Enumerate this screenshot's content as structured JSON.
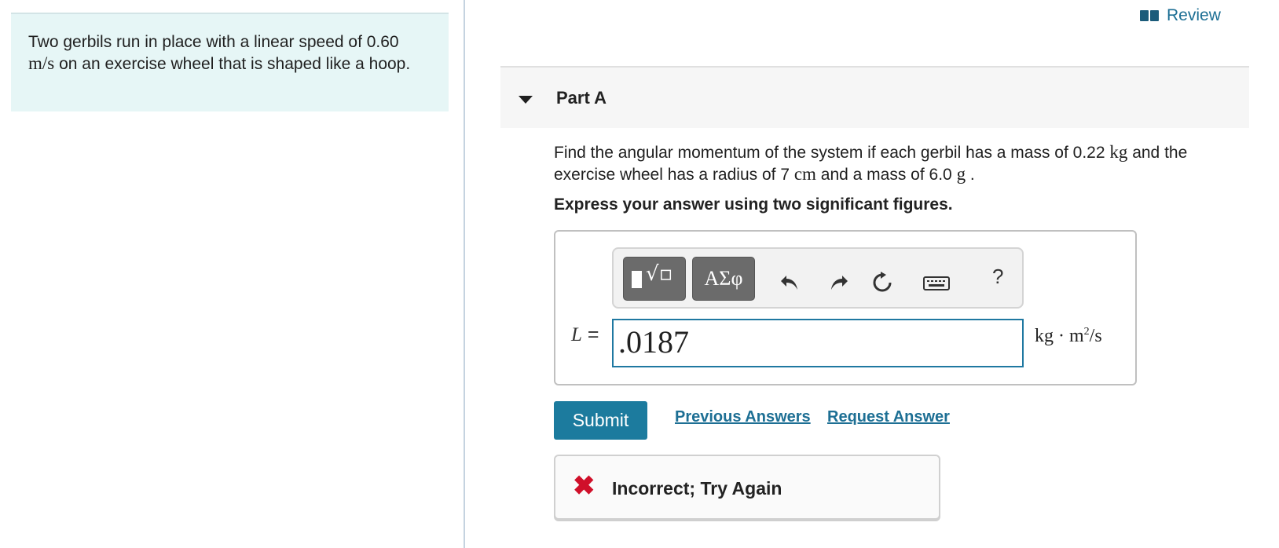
{
  "intro": {
    "text_before": "Two gerbils run in place with a linear speed of 0.60",
    "unit": "m/s",
    "text_after": " on an exercise wheel that is shaped like a hoop."
  },
  "review": {
    "label": "Review",
    "icon": "book-icon"
  },
  "part": {
    "title": "Part A",
    "caret": "caret-down-icon"
  },
  "question": {
    "t1": "Find the angular momentum of the system if each gerbil has a mass of 0.22 ",
    "u1": "kg",
    "t2": " and the exercise wheel has a radius of 7 ",
    "u2": "cm",
    "t3": " and a mass of 6.0 ",
    "u3": "g",
    "t4": " ."
  },
  "instruction": "Express your answer using two significant figures.",
  "toolbar": {
    "templates_icon": "templates-icon",
    "greek_label": "ΑΣφ",
    "undo_icon": "undo-icon",
    "redo_icon": "redo-icon",
    "reset_icon": "reset-icon",
    "keyboard_icon": "keyboard-icon",
    "help_label": "?"
  },
  "answer": {
    "variable": "L",
    "equals": "=",
    "value": ".0187",
    "unit_base": "kg · m",
    "unit_exp": "2",
    "unit_tail": "/s"
  },
  "actions": {
    "submit": "Submit",
    "previous_answers": "Previous Answers",
    "request_answer": "Request Answer"
  },
  "feedback": {
    "icon": "cross-icon",
    "symbol": "✖",
    "message": "Incorrect; Try Again"
  },
  "colors": {
    "accent": "#1c7b9e",
    "error": "#d0102a",
    "intro_bg": "#e6f6f6"
  }
}
